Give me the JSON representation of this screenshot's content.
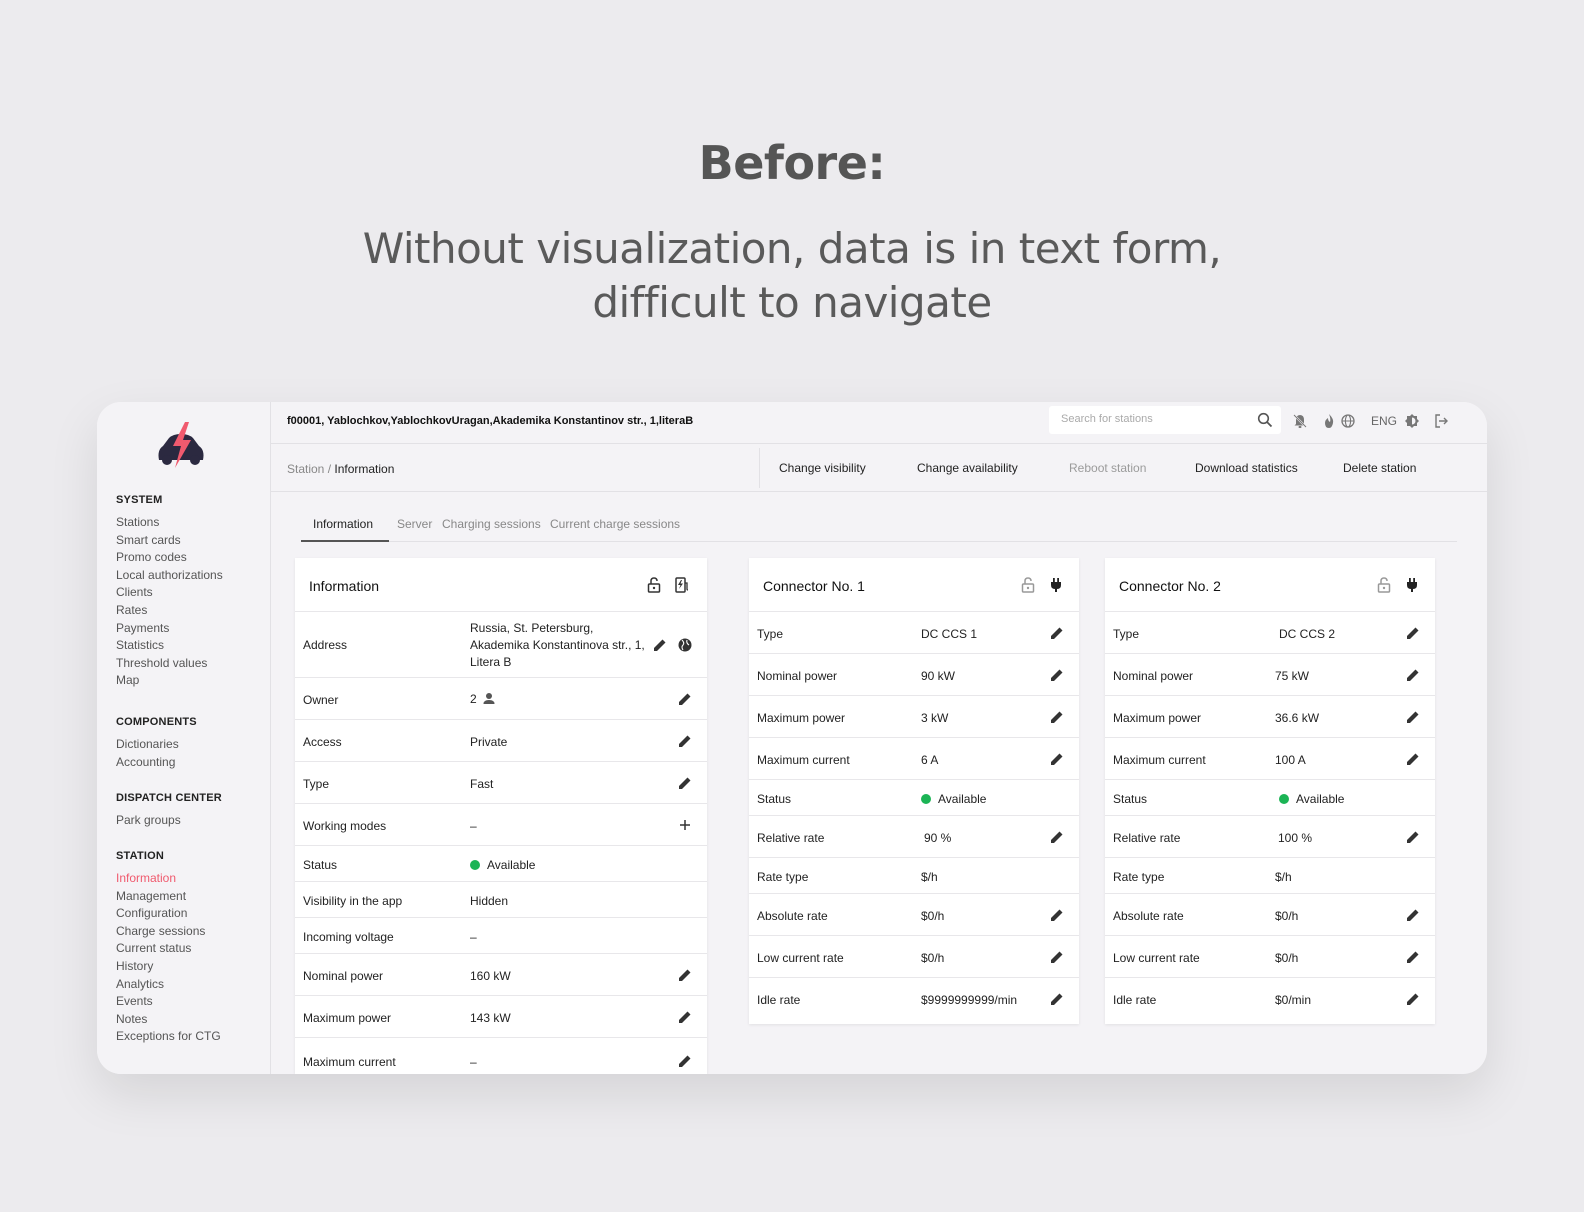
{
  "hero": {
    "title": "Before:",
    "subtitle_line1": "Without visualization, data is in text form,",
    "subtitle_line2": "difficult to navigate"
  },
  "colors": {
    "accent": "#f05a6e",
    "status_green": "#1bb455",
    "logo_dark": "#2b2940"
  },
  "header": {
    "station_title": "f00001, Yablochkov,YablochkovUragan,Akademika Konstantinov str., 1,literaB",
    "search_placeholder": "Search for stations",
    "language": "ENG"
  },
  "breadcrumb": {
    "parent": "Station /",
    "current": "Information"
  },
  "actions": {
    "change_visibility": "Change visibility",
    "change_availability": "Change availability",
    "reboot_station": "Reboot station",
    "download_statistics": "Download statistics",
    "delete_station": "Delete station"
  },
  "tabs": {
    "information": "Information",
    "server": "Server",
    "charging_sessions": "Charging sessions",
    "current_charge_sessions": "Current charge sessions"
  },
  "sidebar": {
    "system": {
      "heading": "SYSTEM",
      "items": [
        "Stations",
        "Smart cards",
        "Promo codes",
        "Local authorizations",
        "Clients",
        "Rates",
        "Payments",
        "Statistics",
        "Threshold values",
        "Map"
      ]
    },
    "components": {
      "heading": "COMPONENTS",
      "items": [
        "Dictionaries",
        "Accounting"
      ]
    },
    "dispatch": {
      "heading": "DISPATCH CENTER",
      "items": [
        "Park groups"
      ]
    },
    "station": {
      "heading": "STATION",
      "items": [
        "Information",
        "Management",
        "Configuration",
        "Charge sessions",
        "Current status",
        "History",
        "Analytics",
        "Events",
        "Notes",
        "Exceptions for CTG"
      ]
    }
  },
  "info_card": {
    "title": "Information",
    "address_label": "Address",
    "address_value": "Russia, St. Petersburg, Akademika Konstantinova str., 1, Litera B",
    "owner_label": "Owner",
    "owner_value": "2",
    "access_label": "Access",
    "access_value": "Private",
    "type_label": "Type",
    "type_value": "Fast",
    "working_modes_label": "Working modes",
    "working_modes_value": "–",
    "status_label": "Status",
    "status_value": "Available",
    "visibility_label": "Visibility in the app",
    "visibility_value": "Hidden",
    "incoming_voltage_label": "Incoming voltage",
    "incoming_voltage_value": "–",
    "nominal_power_label": "Nominal power",
    "nominal_power_value": "160 kW",
    "maximum_power_label": "Maximum power",
    "maximum_power_value": "143 kW",
    "maximum_current_label": "Maximum current",
    "maximum_current_value": "–"
  },
  "connector1": {
    "title": "Connector No. 1",
    "type_label": "Type",
    "type_value": "DC CCS 1",
    "nominal_power_label": "Nominal power",
    "nominal_power_value": "90 kW",
    "maximum_power_label": "Maximum power",
    "maximum_power_value": "3 kW",
    "maximum_current_label": "Maximum current",
    "maximum_current_value": "6 A",
    "status_label": "Status",
    "status_value": "Available",
    "relative_rate_label": "Relative rate",
    "relative_rate_value": "90 %",
    "rate_type_label": "Rate type",
    "rate_type_value": "$/h",
    "absolute_rate_label": "Absolute rate",
    "absolute_rate_value": "$0/h",
    "low_current_rate_label": "Low current rate",
    "low_current_rate_value": "$0/h",
    "idle_rate_label": "Idle rate",
    "idle_rate_value": "$9999999999/min"
  },
  "connector2": {
    "title": "Connector No. 2",
    "type_label": "Type",
    "type_value": "DC CCS 2",
    "nominal_power_label": "Nominal power",
    "nominal_power_value": "75 kW",
    "maximum_power_label": "Maximum power",
    "maximum_power_value": "36.6 kW",
    "maximum_current_label": "Maximum current",
    "maximum_current_value": "100 A",
    "status_label": "Status",
    "status_value": "Available",
    "relative_rate_label": "Relative rate",
    "relative_rate_value": "100 %",
    "rate_type_label": "Rate type",
    "rate_type_value": "$/h",
    "absolute_rate_label": "Absolute rate",
    "absolute_rate_value": "$0/h",
    "low_current_rate_label": "Low current rate",
    "low_current_rate_value": "$0/h",
    "idle_rate_label": "Idle rate",
    "idle_rate_value": "$0/min"
  }
}
